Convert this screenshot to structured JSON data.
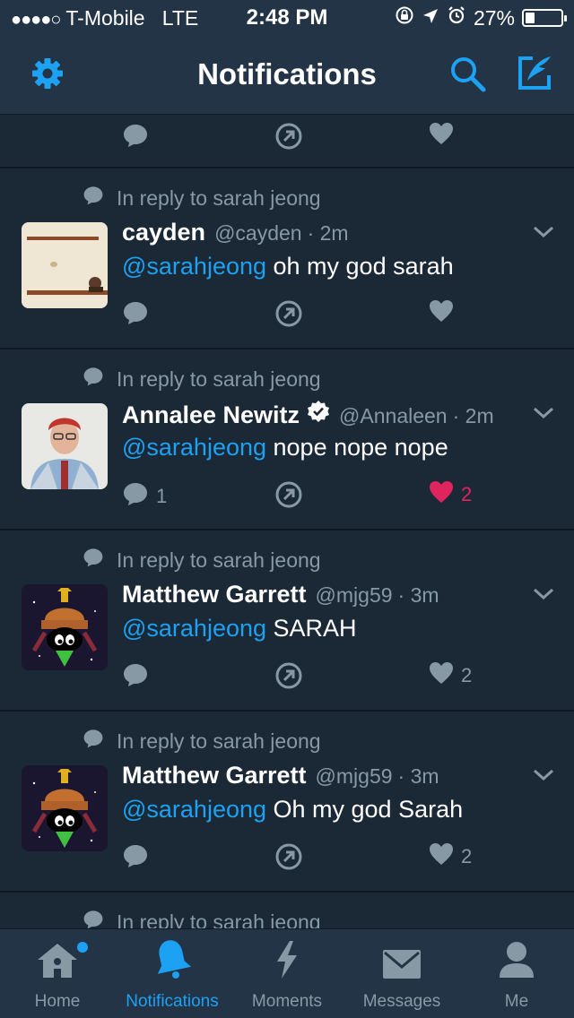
{
  "status_bar": {
    "signal_dots": "●●●●○",
    "carrier": "T-Mobile",
    "network": "LTE",
    "time": "2:48 PM",
    "battery": "27%",
    "battery_level": 0.27
  },
  "header": {
    "title": "Notifications",
    "settings_icon": "gear-icon",
    "search_icon": "search-icon",
    "compose_icon": "compose-icon"
  },
  "colors": {
    "accent": "#1da1f2",
    "background": "#1b2836",
    "bar": "#243447",
    "muted": "#8899a6",
    "like": "#e0245e"
  },
  "tweets": [
    {
      "reply_context": "In reply to sarah jeong",
      "name": "cayden",
      "handle": "@cayden",
      "time": "· 2m",
      "mention": "@sarahjeong",
      "text": " oh my god sarah",
      "reply_count": "",
      "like_count": ""
    },
    {
      "reply_context": "In reply to sarah jeong",
      "name": "Annalee Newitz",
      "handle": "@Annaleen",
      "time": "· 2m",
      "mention": "@sarahjeong",
      "text": " nope nope nope",
      "reply_count": "1",
      "like_count": "2"
    },
    {
      "reply_context": "In reply to sarah jeong",
      "name": "Matthew Garrett",
      "handle": "@mjg59",
      "time": "· 3m",
      "mention": "@sarahjeong",
      "text": " SARAH",
      "reply_count": "",
      "like_count": "2"
    },
    {
      "reply_context": "In reply to sarah jeong",
      "name": "Matthew Garrett",
      "handle": "@mjg59",
      "time": "· 3m",
      "mention": "@sarahjeong",
      "text": " Oh my god Sarah",
      "reply_count": "",
      "like_count": "2"
    },
    {
      "reply_context": "In reply to sarah jeong"
    }
  ],
  "tabs": [
    {
      "label": "Home",
      "icon": "home-icon"
    },
    {
      "label": "Notifications",
      "icon": "bell-icon"
    },
    {
      "label": "Moments",
      "icon": "lightning-icon"
    },
    {
      "label": "Messages",
      "icon": "envelope-icon"
    },
    {
      "label": "Me",
      "icon": "person-icon"
    }
  ]
}
